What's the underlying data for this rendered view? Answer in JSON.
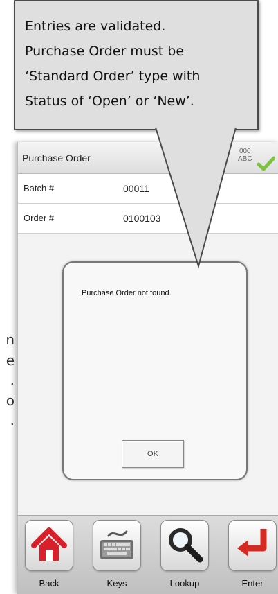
{
  "edge_fragments": [
    "n",
    "e",
    ".",
    "o",
    "."
  ],
  "callout": {
    "lines": [
      "Entries are validated.",
      "Purchase Order must be",
      "‘Standard Order’ type with",
      "Status of ‘Open’ or ‘New’."
    ]
  },
  "header": {
    "title": "Purchase Order",
    "mode_line1": "000",
    "mode_line2": "ABC",
    "status_icon": "check-icon"
  },
  "fields": {
    "batch": {
      "label": "Batch #",
      "value": "00011"
    },
    "order": {
      "label": "Order #",
      "value": "0100103"
    }
  },
  "dialog": {
    "message": "Purchase Order not found.",
    "ok_label": "OK"
  },
  "toolbar": {
    "buttons": [
      {
        "label": "Back",
        "icon": "home-icon"
      },
      {
        "label": "Keys",
        "icon": "keyboard-icon"
      },
      {
        "label": "Lookup",
        "icon": "magnifier-icon"
      },
      {
        "label": "Enter",
        "icon": "enter-arrow-icon"
      }
    ]
  },
  "colors": {
    "callout_fill": "#dfdfdf",
    "check_green": "#7cc241",
    "home_red": "#d8202a",
    "enter_red": "#d42a22"
  }
}
